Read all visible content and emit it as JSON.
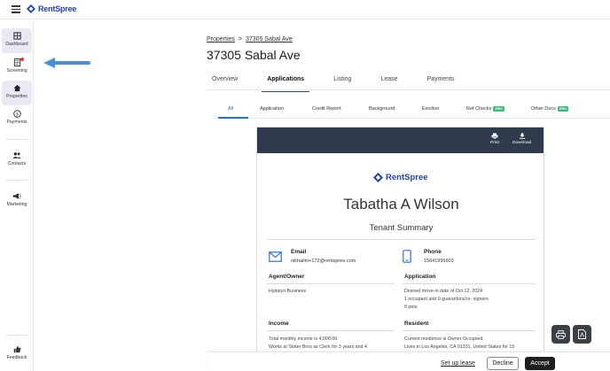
{
  "brand": {
    "name": "RentSpree",
    "color": "#1f3fb4"
  },
  "sidebar": {
    "items": [
      {
        "label": "Dashboard",
        "icon": "dashboard-icon"
      },
      {
        "label": "Screening",
        "icon": "screening-icon",
        "badge": "red-dot"
      },
      {
        "label": "Properties",
        "icon": "home-icon",
        "active": true
      },
      {
        "label": "Payments",
        "icon": "dollar-icon"
      },
      {
        "label": "Contacts",
        "icon": "contacts-icon"
      },
      {
        "label": "Marketing",
        "icon": "megaphone-icon"
      },
      {
        "label": "Feedback",
        "icon": "thumbs-up-icon"
      }
    ]
  },
  "breadcrumb": {
    "root": "Properties",
    "separator": ">",
    "current": "37305 Sabal Ave"
  },
  "page_title": "37305 Sabal Ave",
  "tabs": [
    "Overview",
    "Applications",
    "Listing",
    "Lease",
    "Payments"
  ],
  "active_tab": "Applications",
  "subtabs": [
    {
      "label": "All",
      "active": true
    },
    {
      "label": "Application"
    },
    {
      "label": "Credit Report"
    },
    {
      "label": "Background"
    },
    {
      "label": "Eviction"
    },
    {
      "label": "Ref Checks",
      "badge": "PRO"
    },
    {
      "label": "Other Docs",
      "badge": "PRO"
    }
  ],
  "report": {
    "actions": [
      {
        "label": "Print",
        "icon": "print-icon"
      },
      {
        "label": "Download",
        "icon": "download-icon"
      }
    ],
    "logo_text": "RentSpree",
    "applicant_name": "Tabatha A Wilson",
    "subtitle": "Tenant Summary",
    "email": {
      "label": "Email",
      "value": "nikhailm+172@rentspree.com"
    },
    "phone": {
      "label": "Phone",
      "value": "15641995603"
    },
    "agent": {
      "heading": "Agent/Owner",
      "lines": [
        "Hydalyn Business"
      ]
    },
    "application": {
      "heading": "Application",
      "lines": [
        "Desired move-in date of Oct 12, 2024",
        "1 occupant and 0 guarantors/co- signers",
        "0 pets"
      ]
    },
    "income": {
      "heading": "Income",
      "lines": [
        "Total monthly income is 4,000.00",
        "Works at Stater Bros as Clerk for 3 years and 4"
      ]
    },
    "resident": {
      "heading": "Resident",
      "lines": [
        "Current residence is Owner Occupied.",
        "Lives in Los Angeles, CA 91331, United States for 15"
      ]
    }
  },
  "footer": {
    "setup_lease": "Set up lease",
    "decline": "Decline",
    "accept": "Accept"
  },
  "colors": {
    "accent": "#1f3fb4",
    "tab_active": "#2b6cd4",
    "header_bar": "#2f3a4c",
    "pro_badge": "#3db87a",
    "arrow": "#4a90d9"
  }
}
